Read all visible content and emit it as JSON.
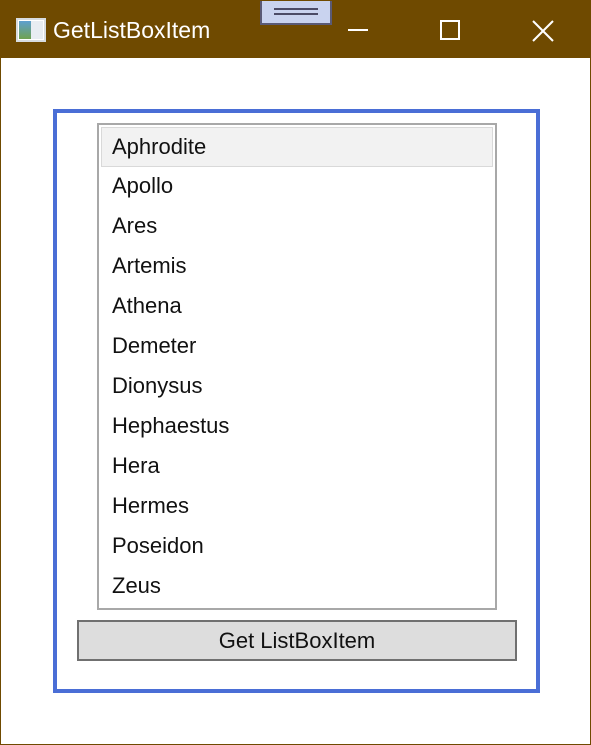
{
  "window": {
    "title": "GetListBoxItem"
  },
  "listbox": {
    "items": [
      {
        "label": "Aphrodite",
        "selected": true
      },
      {
        "label": "Apollo",
        "selected": false
      },
      {
        "label": "Ares",
        "selected": false
      },
      {
        "label": "Artemis",
        "selected": false
      },
      {
        "label": "Athena",
        "selected": false
      },
      {
        "label": "Demeter",
        "selected": false
      },
      {
        "label": "Dionysus",
        "selected": false
      },
      {
        "label": "Hephaestus",
        "selected": false
      },
      {
        "label": "Hera",
        "selected": false
      },
      {
        "label": "Hermes",
        "selected": false
      },
      {
        "label": "Poseidon",
        "selected": false
      },
      {
        "label": "Zeus",
        "selected": false
      }
    ]
  },
  "button": {
    "label": "Get ListBoxItem"
  },
  "colors": {
    "titlebar": "#6f4a00",
    "accent_border": "#4a6ed6",
    "list_border": "#a8a8a8",
    "button_bg": "#dddddd"
  },
  "icons": {
    "app": "app-window-icon",
    "drag": "drag-handle-icon",
    "minimize": "minimize-icon",
    "maximize": "maximize-icon",
    "close": "close-icon"
  }
}
